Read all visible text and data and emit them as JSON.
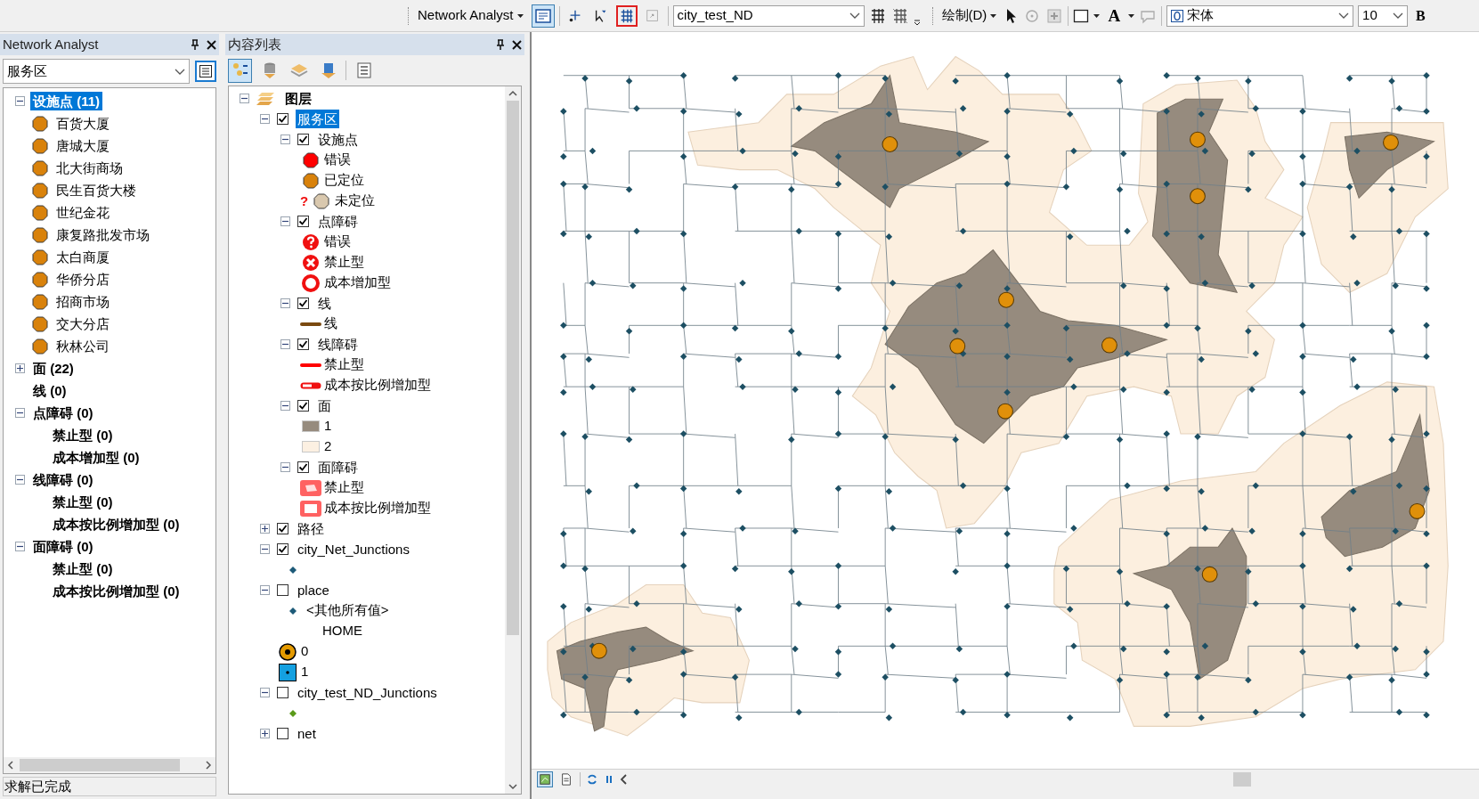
{
  "toolbar": {
    "network_menu": "Network Analyst",
    "network_window_selected": true,
    "tools": [
      {
        "kind": "add-location",
        "highlighted": false,
        "disabled": false
      },
      {
        "kind": "select-move",
        "highlighted": false,
        "disabled": false
      },
      {
        "kind": "solve",
        "highlighted": true,
        "disabled": false
      },
      {
        "kind": "directions",
        "highlighted": false,
        "disabled": true
      }
    ],
    "network_dataset": "city_test_ND",
    "draw_menu": "绘制(D)",
    "font_color_label": "A",
    "font_name": "宋体",
    "font_size": "10",
    "bold_label": "B"
  },
  "network_analyst": {
    "title": "Network Analyst",
    "analysis_layer": "服务区",
    "tree": [
      {
        "label": "设施点 (11)",
        "kind": "category",
        "expanded": true,
        "selected": true,
        "children": [
          {
            "label": "百货大厦",
            "kind": "facility",
            "selected": false
          },
          {
            "label": "唐城大厦",
            "kind": "facility",
            "selected": false
          },
          {
            "label": "北大街商场",
            "kind": "facility",
            "selected": false
          },
          {
            "label": "民生百货大楼",
            "kind": "facility",
            "selected": false
          },
          {
            "label": "世纪金花",
            "kind": "facility",
            "selected": false
          },
          {
            "label": "康复路批发市场",
            "kind": "facility",
            "selected": false
          },
          {
            "label": "太白商厦",
            "kind": "facility",
            "selected": false
          },
          {
            "label": "华侨分店",
            "kind": "facility",
            "selected": false
          },
          {
            "label": "招商市场",
            "kind": "facility",
            "selected": false
          },
          {
            "label": "交大分店",
            "kind": "facility",
            "selected": false
          },
          {
            "label": "秋林公司",
            "kind": "facility",
            "selected": false
          }
        ]
      },
      {
        "label": "面 (22)",
        "kind": "category",
        "expanded": false,
        "selected": false
      },
      {
        "label": "线 (0)",
        "kind": "category",
        "selected": false
      },
      {
        "label": "点障碍 (0)",
        "kind": "category",
        "expanded": true,
        "selected": false,
        "children": [
          {
            "label": "禁止型 (0)",
            "kind": "class",
            "selected": false
          },
          {
            "label": "成本增加型 (0)",
            "kind": "class",
            "selected": false
          }
        ]
      },
      {
        "label": "线障碍 (0)",
        "kind": "category",
        "expanded": true,
        "selected": false,
        "children": [
          {
            "label": "禁止型 (0)",
            "kind": "class",
            "selected": false
          },
          {
            "label": "成本按比例增加型 (0)",
            "kind": "class",
            "selected": false
          }
        ]
      },
      {
        "label": "面障碍 (0)",
        "kind": "category",
        "expanded": true,
        "selected": false,
        "children": [
          {
            "label": "禁止型 (0)",
            "kind": "class",
            "selected": false
          },
          {
            "label": "成本按比例增加型 (0)",
            "kind": "class",
            "selected": false
          }
        ]
      }
    ],
    "status": "求解已完成"
  },
  "contents": {
    "title": "内容列表",
    "view_tabs": [
      {
        "kind": "drawing-order",
        "selected": true
      },
      {
        "kind": "source",
        "selected": false
      },
      {
        "kind": "visibility",
        "selected": false
      },
      {
        "kind": "selection",
        "selected": false
      },
      {
        "kind": "options",
        "selected": false
      }
    ],
    "tree": [
      {
        "label": "图层",
        "expanded": true,
        "children": [
          {
            "label": "服务区",
            "checked": true,
            "expanded": true,
            "selected": true,
            "children": [
              {
                "label": "设施点",
                "checked": true,
                "expanded": true,
                "selected": false,
                "children": [
                  {
                    "kind": "octagon",
                    "color": "#ff0000",
                    "label": "错误"
                  },
                  {
                    "kind": "octagon",
                    "color": "#d9820b",
                    "label": "已定位"
                  },
                  {
                    "kind": "octagon",
                    "color": "#d9c8ae",
                    "mark": "?",
                    "label": "未定位"
                  }
                ]
              },
              {
                "label": "点障碍",
                "checked": true,
                "expanded": true,
                "selected": false,
                "children": [
                  {
                    "kind": "question",
                    "label": "错误"
                  },
                  {
                    "kind": "cross",
                    "label": "禁止型"
                  },
                  {
                    "kind": "ring",
                    "label": "成本增加型"
                  }
                ]
              },
              {
                "label": "线",
                "checked": true,
                "expanded": true,
                "selected": false,
                "children": [
                  {
                    "kind": "line",
                    "color": "#7a4a10",
                    "label": "线"
                  }
                ]
              },
              {
                "label": "线障碍",
                "checked": true,
                "expanded": true,
                "selected": false,
                "children": [
                  {
                    "kind": "line",
                    "color": "#ff0000",
                    "label": "禁止型"
                  },
                  {
                    "kind": "hollow-line",
                    "label": "成本按比例增加型"
                  }
                ]
              },
              {
                "label": "面",
                "checked": true,
                "expanded": true,
                "selected": false,
                "children": [
                  {
                    "kind": "swatch",
                    "color": "#968b7e",
                    "label": "1"
                  },
                  {
                    "kind": "swatch",
                    "color": "#fcf0e2",
                    "label": "2"
                  }
                ]
              },
              {
                "label": "面障碍",
                "checked": true,
                "expanded": true,
                "selected": false,
                "children": [
                  {
                    "kind": "polygon",
                    "label": "禁止型"
                  },
                  {
                    "kind": "hollow-polygon",
                    "label": "成本按比例增加型"
                  }
                ]
              }
            ]
          },
          {
            "label": "路径",
            "checked": true,
            "expanded": false,
            "selected": false
          },
          {
            "label": "city_Net_Junctions",
            "checked": true,
            "expanded": true,
            "selected": false,
            "children": [
              {
                "kind": "diamond",
                "color": "#1d5a78"
              }
            ]
          },
          {
            "label": "place",
            "checked": false,
            "expanded": true,
            "selected": false,
            "children": [
              {
                "kind": "diamond",
                "color": "#1d5a78",
                "label": "<其他所有值>"
              },
              {
                "kind": "heading",
                "label": "HOME"
              },
              {
                "kind": "target",
                "label": "0"
              },
              {
                "kind": "square",
                "label": "1"
              }
            ]
          },
          {
            "label": "city_test_ND_Junctions",
            "checked": false,
            "expanded": true,
            "selected": false,
            "children": [
              {
                "kind": "diamond",
                "color": "#5a9a1a"
              }
            ]
          },
          {
            "label": "net",
            "checked": false,
            "expanded": false,
            "selected": false
          }
        ]
      }
    ]
  },
  "map_bar": {
    "views": [
      {
        "kind": "data",
        "selected": true
      },
      {
        "kind": "layout",
        "selected": false
      }
    ]
  }
}
